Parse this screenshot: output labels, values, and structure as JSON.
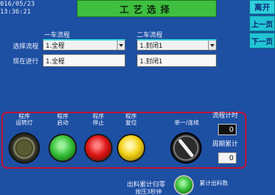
{
  "header": {
    "date": "016/05/23",
    "time": "13:36:21",
    "title": "工艺选择"
  },
  "nav": {
    "exit_label": "离开",
    "prev_label": "上一页",
    "next_label": "下一页"
  },
  "process": {
    "select_label": "选择流程",
    "current_label": "现在进行",
    "car1": {
      "label": "一车流程",
      "selected": "1.全程",
      "current": "1.全程"
    },
    "car2": {
      "label": "二车流程",
      "selected": "1.封闭1",
      "current": "1.封闭1"
    }
  },
  "controls": {
    "run_lamp_label": "程序\n运转灯",
    "start_label": "程序\n启动",
    "stop_label": "程序\n停止",
    "reset_label": "程序\n复位",
    "mode_label": "单一/连续",
    "process_timer_label": "流程计时",
    "process_timer_value": "0",
    "cycle_total_label": "周期累计",
    "cycle_total_value": "0"
  },
  "footer": {
    "clear_label": "出料累计归零",
    "clear_sub_label": "按压3秒钟",
    "total_label": "累计出料数"
  },
  "colors": {
    "background": "#1d4fa3",
    "title_bg": "#3fbf3f",
    "nav_btn": "#21c4d4",
    "panel_border": "#c8102e",
    "start_btn": "#3cc43c",
    "stop_btn": "#e01818",
    "reset_btn": "#f4d21a"
  }
}
